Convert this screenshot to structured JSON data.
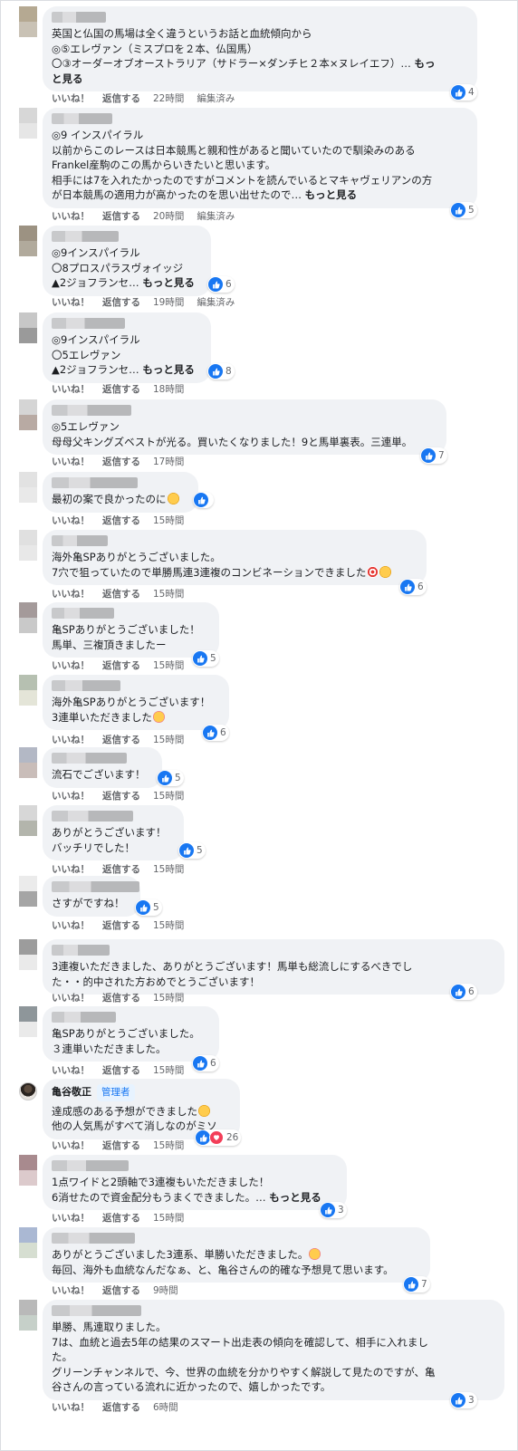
{
  "labels": {
    "like": "いいね！",
    "reply": "返信する",
    "edited": "編集済み",
    "more": "もっと見る"
  },
  "colors": {
    "accent": "#1877f2",
    "bubble": "#f0f2f5",
    "meta": "#65676b"
  },
  "comments": [
    {
      "lines": [
        "英国と仏国の馬場は全く違うというお話と血統傾向から",
        "◎⑤エレヴァン（ミスプロを２本、仏国馬）",
        "〇③オーダーオブオーストラリア（サドラー×ダンチヒ２本×ヌレイエフ）… もっ",
        "と見る"
      ],
      "reactions": "4",
      "time": "22時間",
      "edited": true
    },
    {
      "lines": [
        "◎9 インスパイラル",
        "以前からこのレースは日本競馬と親和性があると聞いていたので馴染みのある",
        "Frankel産駒のこの馬からいきたいと思います。",
        "相手には7を入れたかったのですがコメントを読んでいるとマキャヴェリアンの方",
        "が日本競馬の適用力が高かったのを思い出せたので… もっと見る"
      ],
      "reactions": "5",
      "time": "20時間",
      "edited": true
    },
    {
      "lines": [
        "◎9インスパイラル",
        "〇8プロスパラスヴォイッジ",
        "▲2ジョフランセ… もっと見る"
      ],
      "reactions": "6",
      "time": "19時間",
      "edited": true
    },
    {
      "lines": [
        "◎9インスパイラル",
        "〇5エレヴァン",
        "▲2ジョフランセ… もっと見る"
      ],
      "reactions": "8",
      "time": "18時間",
      "edited": false
    },
    {
      "lines": [
        "◎5エレヴァン",
        "母母父キングズベストが光る。買いたくなりました！9と馬単裏表。三連単。"
      ],
      "reactions": "7",
      "time": "17時間",
      "edited": false
    },
    {
      "lines": [
        "最初の案で良かったのに"
      ],
      "reactions": "",
      "time": "15時間",
      "edited": false
    },
    {
      "lines": [
        "海外亀SPありがとうございました。",
        "7穴で狙っていたので単勝馬連3連複のコンビネーションできました"
      ],
      "reactions": "6",
      "time": "15時間",
      "edited": false
    },
    {
      "lines": [
        "亀SPありがとうございました！",
        "馬単、三複頂きましたー"
      ],
      "reactions": "5",
      "time": "15時間",
      "edited": false
    },
    {
      "lines": [
        "海外亀SPありがとうございます！",
        "3連単いただきました"
      ],
      "reactions": "6",
      "time": "15時間",
      "edited": false
    },
    {
      "lines": [
        "流石でございます！"
      ],
      "reactions": "5",
      "time": "15時間",
      "edited": false
    },
    {
      "lines": [
        "ありがとうございます！",
        "バッチリでした！"
      ],
      "reactions": "5",
      "time": "15時間",
      "edited": false
    },
    {
      "lines": [
        "さすがですね！"
      ],
      "reactions": "5",
      "time": "15時間",
      "edited": false
    },
    {
      "lines": [
        "3連複いただきました、ありがとうございます！馬単も総流しにするべきでし",
        "た・・的中された方おめでとうございます！"
      ],
      "reactions": "6",
      "time": "15時間",
      "edited": false
    },
    {
      "lines": [
        "亀SPありがとうございました。",
        "３連単いただきました。"
      ],
      "reactions": "6",
      "time": "15時間",
      "edited": false
    },
    {
      "author": "亀谷敬正",
      "badge": "管理者",
      "lines": [
        "達成感のある予想ができました",
        "他の人気馬がすべて消しなのがミソ"
      ],
      "reactions": "26",
      "time": "15時間",
      "edited": false
    },
    {
      "lines": [
        "1点ワイドと2頭軸で3連複もいただきました！",
        "6消せたので資金配分もうまくできました。… もっと見る"
      ],
      "reactions": "3",
      "time": "15時間",
      "edited": false
    },
    {
      "lines": [
        "ありがとうございました3連系、単勝いただきました。",
        "毎回、海外も血統なんだなぁ、と、亀谷さんの的確な予想見て思います。"
      ],
      "reactions": "7",
      "time": "9時間",
      "edited": false
    },
    {
      "lines": [
        "単勝、馬連取りました。",
        "7は、血統と過去5年の結果のスマート出走表の傾向を確認して、相手に入れまし",
        "た。",
        "グリーンチャンネルで、今、世界の血統を分かりやすく解説して見たのですが、亀",
        "谷さんの言っている流れに近かったので、嬉しかったです。"
      ],
      "reactions": "3",
      "time": "6時間",
      "edited": false
    }
  ]
}
